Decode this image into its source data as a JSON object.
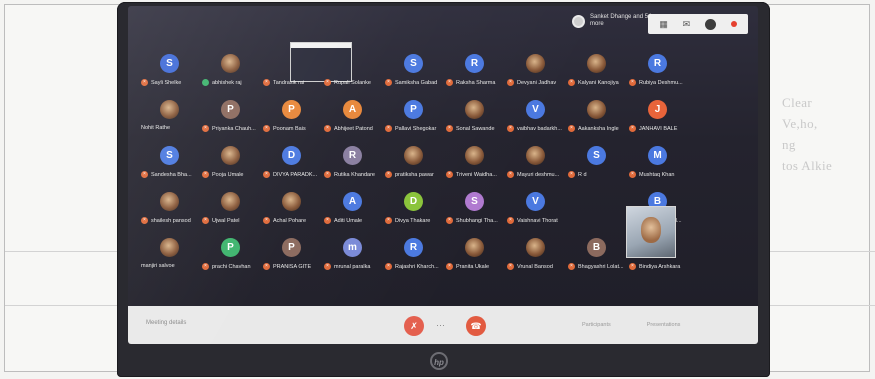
{
  "meeting": {
    "topbar_text": "Sanket Dhange and 54 more",
    "details_label": "Meeting details"
  },
  "tiles": [
    {
      "name": "Sayli Shelke",
      "initial": "S",
      "color": "#3f6ad8",
      "mic": "muted",
      "photo": false
    },
    {
      "name": "abhishek raj",
      "initial": "",
      "color": "#3f6ad8",
      "mic": "active",
      "photo": true
    },
    {
      "name": "Tandrasik rai",
      "initial": "",
      "color": "#3f6ad8",
      "mic": "muted",
      "photo": false,
      "blank": true
    },
    {
      "name": "Rupali Solanke",
      "initial": "",
      "color": "#3f6ad8",
      "mic": "muted",
      "photo": false,
      "blank": true
    },
    {
      "name": "Samiksha Gabad",
      "initial": "S",
      "color": "#4b79e0",
      "mic": "muted",
      "photo": false
    },
    {
      "name": "Raksha Sharma",
      "initial": "R",
      "color": "#4b79e0",
      "mic": "muted",
      "photo": false
    },
    {
      "name": "Devyani Jadhav",
      "initial": "",
      "color": "#4b79e0",
      "mic": "muted",
      "photo": true
    },
    {
      "name": "Kalyani Kanojiya",
      "initial": "",
      "color": "#4b79e0",
      "mic": "muted",
      "photo": true
    },
    {
      "name": "Rubiya Deshmu...",
      "initial": "R",
      "color": "#4b79e0",
      "mic": "muted",
      "photo": false
    },
    {
      "name": "",
      "initial": "",
      "color": "#4b79e0",
      "mic": "none",
      "photo": false,
      "blank": true
    },
    {
      "name": "Nohit Rathe",
      "initial": "",
      "color": "#8a6a3a",
      "mic": "none",
      "photo": true
    },
    {
      "name": "Priyanka Chauh...",
      "initial": "P",
      "color": "#8c6a5e",
      "mic": "muted",
      "photo": false
    },
    {
      "name": "Poonam Bais",
      "initial": "P",
      "color": "#e8873a",
      "mic": "muted",
      "photo": false
    },
    {
      "name": "Abhijeet Patond",
      "initial": "A",
      "color": "#e8873a",
      "mic": "muted",
      "photo": false
    },
    {
      "name": "Pallavi Shegokar",
      "initial": "P",
      "color": "#4b79e0",
      "mic": "muted",
      "photo": false
    },
    {
      "name": "Sonal Sawande",
      "initial": "",
      "color": "#4b79e0",
      "mic": "muted",
      "photo": true
    },
    {
      "name": "vaibhav badarkh...",
      "initial": "V",
      "color": "#4b79e0",
      "mic": "muted",
      "photo": false
    },
    {
      "name": "Aakanksha Ingle",
      "initial": "",
      "color": "#4b79e0",
      "mic": "muted",
      "photo": true
    },
    {
      "name": "JANHAVI BALE",
      "initial": "J",
      "color": "#e8643a",
      "mic": "muted",
      "photo": false
    },
    {
      "name": "",
      "initial": "",
      "color": "#4b79e0",
      "mic": "none",
      "photo": false,
      "blank": true
    },
    {
      "name": "Sandesha Bha...",
      "initial": "S",
      "color": "#4b79e0",
      "mic": "muted",
      "photo": false
    },
    {
      "name": "Pooja Umale",
      "initial": "",
      "color": "#4b79e0",
      "mic": "muted",
      "photo": true
    },
    {
      "name": "DIVYA PARADK...",
      "initial": "D",
      "color": "#4b79e0",
      "mic": "muted",
      "photo": false
    },
    {
      "name": "Rutika Khandare",
      "initial": "R",
      "color": "#8a7fa0",
      "mic": "muted",
      "photo": false
    },
    {
      "name": "pratiksha pawar",
      "initial": "",
      "color": "#8a7fa0",
      "mic": "muted",
      "photo": true
    },
    {
      "name": "Triveni Waidha...",
      "initial": "",
      "color": "#8a7fa0",
      "mic": "muted",
      "photo": true
    },
    {
      "name": "Mayuri deshmu...",
      "initial": "",
      "color": "#8a7fa0",
      "mic": "muted",
      "photo": true
    },
    {
      "name": "R d",
      "initial": "S",
      "color": "#4b79e0",
      "mic": "muted",
      "photo": false
    },
    {
      "name": "Mushtaq Khan",
      "initial": "M",
      "color": "#4b79e0",
      "mic": "muted",
      "photo": false
    },
    {
      "name": "",
      "initial": "",
      "color": "#4b79e0",
      "mic": "none",
      "photo": false,
      "blank": true
    },
    {
      "name": "shailesh pansod",
      "initial": "",
      "color": "#4b79e0",
      "mic": "muted",
      "photo": true
    },
    {
      "name": "Ujwal Patel",
      "initial": "",
      "color": "#4b79e0",
      "mic": "muted",
      "photo": true
    },
    {
      "name": "Achal Pohare",
      "initial": "",
      "color": "#4b79e0",
      "mic": "muted",
      "photo": true
    },
    {
      "name": "Aditi Umale",
      "initial": "A",
      "color": "#4b79e0",
      "mic": "muted",
      "photo": false
    },
    {
      "name": "Divya Thakare",
      "initial": "D",
      "color": "#8ac43a",
      "mic": "muted",
      "photo": false
    },
    {
      "name": "Shubhangi Tha...",
      "initial": "S",
      "color": "#b07ad0",
      "mic": "muted",
      "photo": false
    },
    {
      "name": "Vaishnavi Thorat",
      "initial": "V",
      "color": "#4b79e0",
      "mic": "muted",
      "photo": false
    },
    {
      "name": "",
      "initial": "",
      "color": "#4b79e0",
      "mic": "none",
      "photo": false,
      "blank": true
    },
    {
      "name": "Bhagyashree N...",
      "initial": "B",
      "color": "#4b79e0",
      "mic": "muted",
      "photo": false
    },
    {
      "name": "",
      "initial": "",
      "color": "#4b79e0",
      "mic": "none",
      "photo": false,
      "blank": true
    },
    {
      "name": "manjiri salvoe",
      "initial": "",
      "color": "#8a6a3a",
      "mic": "none",
      "photo": true
    },
    {
      "name": "prachi Chavhan",
      "initial": "P",
      "color": "#3db46d",
      "mic": "muted",
      "photo": false
    },
    {
      "name": "PRANISA GITE",
      "initial": "P",
      "color": "#8c6a5e",
      "mic": "muted",
      "photo": false
    },
    {
      "name": "mrunal paralka",
      "initial": "m",
      "color": "#7a8ad8",
      "mic": "muted",
      "photo": false
    },
    {
      "name": "Rajashri Kharch...",
      "initial": "R",
      "color": "#4b79e0",
      "mic": "muted",
      "photo": false
    },
    {
      "name": "Pranita Ukale",
      "initial": "",
      "color": "#4b79e0",
      "mic": "muted",
      "photo": true
    },
    {
      "name": "Vrunal Bansod",
      "initial": "",
      "color": "#4b79e0",
      "mic": "muted",
      "photo": true
    },
    {
      "name": "Bhagyashri Lolat...",
      "initial": "B",
      "color": "#8c6a5e",
      "mic": "muted",
      "photo": false
    },
    {
      "name": "Bindiya Arshkara",
      "initial": "B",
      "color": "#b07ad0",
      "mic": "muted",
      "photo": false
    },
    {
      "name": "",
      "initial": "",
      "color": "#4b79e0",
      "mic": "none",
      "photo": false,
      "blank": true
    }
  ],
  "controls": {
    "mic_icon": "mic-off-icon",
    "more_icon": "more-icon",
    "end_icon": "end-call-icon",
    "right_labels": [
      "Participants",
      "Presentations"
    ]
  },
  "paper_text": {
    "left": [
      "",
      "",
      "",
      ""
    ],
    "right": [
      "Clear",
      "Ve,ho,",
      "ng",
      "tos Alkie"
    ]
  },
  "brand": "hp"
}
